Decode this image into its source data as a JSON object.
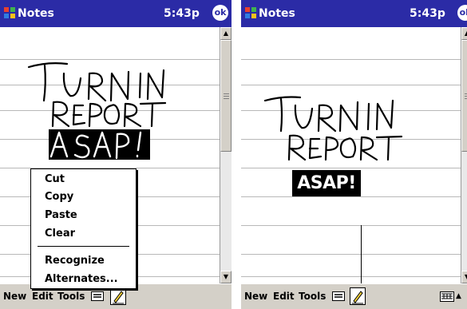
{
  "app": {
    "title": "Notes",
    "time": "5:43p",
    "ok_label": "ok"
  },
  "menubar": {
    "new": "New",
    "edit": "Edit",
    "tools": "Tools"
  },
  "note": {
    "ink_lines": [
      "TURN IN",
      "REPORT",
      "A SAP!"
    ]
  },
  "context_menu": {
    "items": [
      "Cut",
      "Copy",
      "Paste",
      "Clear"
    ],
    "items_secondary": [
      "Recognize",
      "Alternates..."
    ]
  },
  "recognized": {
    "text": "ASAP!"
  },
  "colors": {
    "titlebar": "#2b2ba6",
    "menubar": "#d4d0c8",
    "selection": "#000000"
  }
}
